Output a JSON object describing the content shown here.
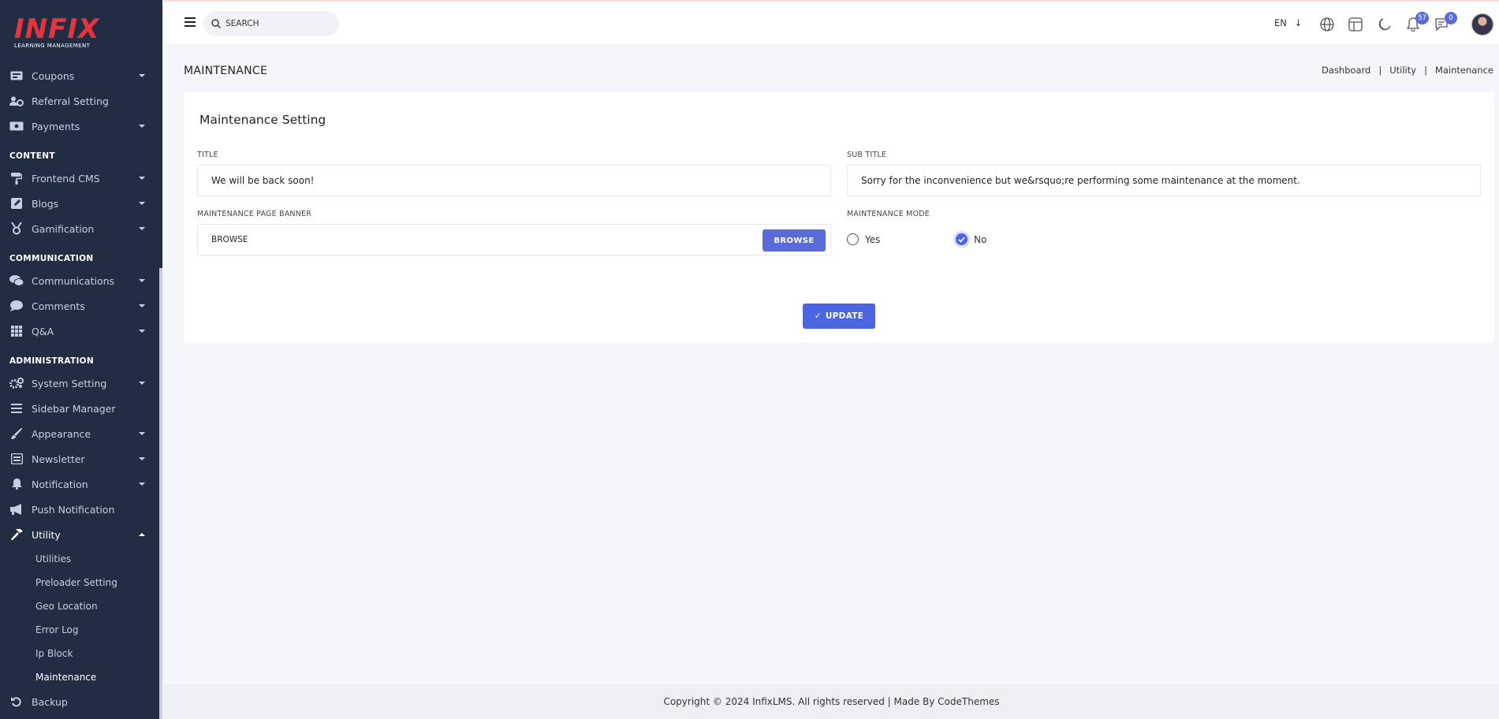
{
  "brand": {
    "logo": "INFIX",
    "tagline": "LEARNING MANAGEMENT"
  },
  "sidebar": {
    "items_top": [
      {
        "label": "Coupons",
        "icon": "coupon-icon",
        "caret": true
      },
      {
        "label": "Referral Setting",
        "icon": "users-cog-icon",
        "caret": false
      },
      {
        "label": "Payments",
        "icon": "money-icon",
        "caret": true
      }
    ],
    "section_content": "CONTENT",
    "items_content": [
      {
        "label": "Frontend CMS",
        "icon": "paint-roller-icon",
        "caret": true
      },
      {
        "label": "Blogs",
        "icon": "edit-icon",
        "caret": true
      },
      {
        "label": "Gamification",
        "icon": "medal-icon",
        "caret": true
      }
    ],
    "section_communication": "COMMUNICATION",
    "items_communication": [
      {
        "label": "Communications",
        "icon": "chat-icon",
        "caret": true
      },
      {
        "label": "Comments",
        "icon": "comment-icon",
        "caret": true
      },
      {
        "label": "Q&A",
        "icon": "grid-icon",
        "caret": true
      }
    ],
    "section_administration": "ADMINISTRATION",
    "items_admin": [
      {
        "label": "System Setting",
        "icon": "cogs-icon",
        "caret": true
      },
      {
        "label": "Sidebar Manager",
        "icon": "bars-icon",
        "caret": false
      },
      {
        "label": "Appearance",
        "icon": "brush-icon",
        "caret": true
      },
      {
        "label": "Newsletter",
        "icon": "newsletter-icon",
        "caret": true
      },
      {
        "label": "Notification",
        "icon": "bell-icon",
        "caret": true
      },
      {
        "label": "Push Notification",
        "icon": "megaphone-icon",
        "caret": false
      },
      {
        "label": "Utility",
        "icon": "hammer-icon",
        "caret": true
      }
    ],
    "utility_sub": [
      "Utilities",
      "Preloader Setting",
      "Geo Location",
      "Error Log",
      "Ip Block",
      "Maintenance"
    ],
    "backup": {
      "label": "Backup",
      "icon": "undo-icon"
    }
  },
  "topbar": {
    "search_placeholder": "SEARCH",
    "lang": "EN",
    "notifications_count": "57",
    "messages_count": "0"
  },
  "page": {
    "title": "MAINTENANCE",
    "breadcrumb": [
      "Dashboard",
      "Utility",
      "Maintenance"
    ]
  },
  "form": {
    "card_title": "Maintenance Setting",
    "title_label": "TITLE",
    "title_value": "We will be back soon!",
    "subtitle_label": "SUB TITLE",
    "subtitle_value": "Sorry for the inconvenience but we&rsquo;re performing some maintenance at the moment.",
    "banner_label": "MAINTENANCE PAGE BANNER",
    "banner_placeholder": "BROWSE",
    "browse_button": "BROWSE",
    "mode_label": "MAINTENANCE MODE",
    "mode_yes": "Yes",
    "mode_no": "No",
    "mode_selected": "No",
    "update_button": "UPDATE"
  },
  "footer": {
    "text": "Copyright © 2024 InfixLMS. All rights reserved | Made By CodeThemes"
  },
  "colors": {
    "sidebar_bg": "#222d44",
    "accent": "#4b66e0",
    "brand_red": "#e3353d"
  }
}
